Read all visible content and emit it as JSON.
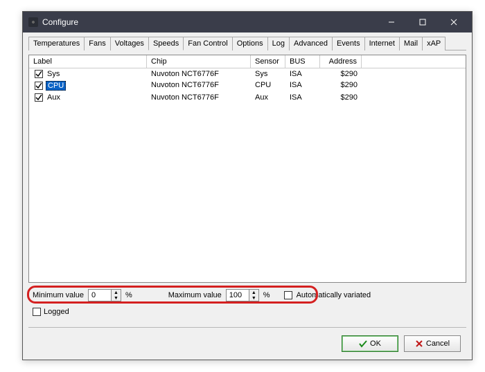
{
  "window": {
    "title": "Configure"
  },
  "tabs": [
    "Temperatures",
    "Fans",
    "Voltages",
    "Speeds",
    "Fan Control",
    "Options",
    "Log",
    "Advanced",
    "Events",
    "Internet",
    "Mail",
    "xAP"
  ],
  "active_tab_index": 3,
  "columns": [
    "Label",
    "Chip",
    "Sensor",
    "BUS",
    "Address"
  ],
  "rows": [
    {
      "checked": true,
      "selected": false,
      "label": "Sys",
      "chip": "Nuvoton NCT6776F",
      "sensor": "Sys",
      "bus": "ISA",
      "address": "$290"
    },
    {
      "checked": true,
      "selected": true,
      "label": "CPU",
      "chip": "Nuvoton NCT6776F",
      "sensor": "CPU",
      "bus": "ISA",
      "address": "$290"
    },
    {
      "checked": true,
      "selected": false,
      "label": "Aux",
      "chip": "Nuvoton NCT6776F",
      "sensor": "Aux",
      "bus": "ISA",
      "address": "$290"
    }
  ],
  "min_label": "Minimum value",
  "min_value": "0",
  "max_label": "Maximum value",
  "max_value": "100",
  "percent": "%",
  "auto_variated": {
    "label": "Automatically variated",
    "checked": false
  },
  "logged": {
    "label": "Logged",
    "checked": false
  },
  "buttons": {
    "ok": "OK",
    "cancel": "Cancel"
  }
}
